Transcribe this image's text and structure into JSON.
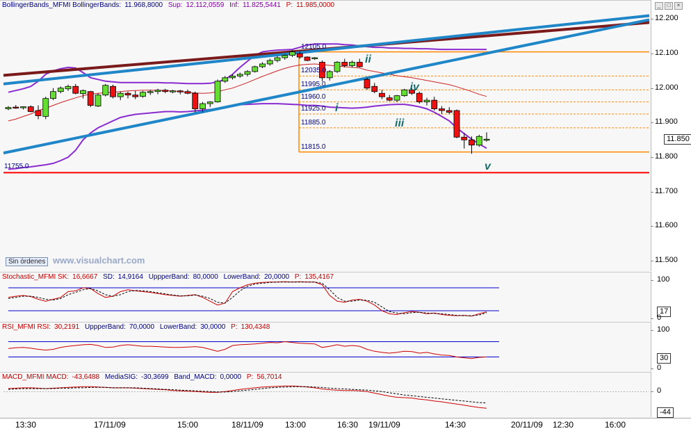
{
  "chart_data": [
    {
      "type": "candlestick",
      "pane": "price",
      "title": "BollingerBands_MFMI BollingerBands:",
      "header_values": [
        {
          "label": "BollingerBands_MFMI BollingerBands:",
          "value": "11.968,8000",
          "color": "#000080"
        },
        {
          "label": "Sup:",
          "value": "12.112,0559",
          "color": "#8000a0"
        },
        {
          "label": "Inf:",
          "value": "11.825,5441",
          "color": "#8000a0"
        },
        {
          "label": "P:",
          "value": "11.985,0000",
          "color": "#c00000"
        }
      ],
      "ylim": [
        11480,
        12225
      ],
      "y_ticks": [
        "12.200",
        "12.100",
        "12.000",
        "11.900",
        "11.800",
        "11.700",
        "11.600",
        "11.500"
      ],
      "y_tick_values": [
        12200,
        12100,
        12000,
        11900,
        11800,
        11700,
        11600,
        11500
      ],
      "last_price": "11.850",
      "candles": [
        [
          11940,
          11948,
          11936,
          11944
        ],
        [
          11945,
          11951,
          11940,
          11943
        ],
        [
          11944,
          11947,
          11938,
          11946
        ],
        [
          11946,
          11950,
          11930,
          11932
        ],
        [
          11935,
          11950,
          11910,
          11920
        ],
        [
          11918,
          11975,
          11910,
          11970
        ],
        [
          11970,
          12000,
          11965,
          11990
        ],
        [
          11990,
          12005,
          11985,
          12000
        ],
        [
          11998,
          12010,
          11992,
          12005
        ],
        [
          12005,
          12012,
          11982,
          11985
        ],
        [
          11984,
          11996,
          11970,
          11993
        ],
        [
          11990,
          11992,
          11945,
          11950
        ],
        [
          11948,
          11985,
          11945,
          11980
        ],
        [
          11980,
          12012,
          11976,
          12008
        ],
        [
          12005,
          12010,
          11970,
          11975
        ],
        [
          11975,
          11990,
          11965,
          11985
        ],
        [
          11985,
          11990,
          11970,
          11980
        ],
        [
          11980,
          11992,
          11968,
          11975
        ],
        [
          11976,
          11992,
          11972,
          11988
        ],
        [
          11988,
          11995,
          11980,
          11990
        ],
        [
          11990,
          11998,
          11982,
          11994
        ],
        [
          11994,
          11998,
          11985,
          11990
        ],
        [
          11990,
          11995,
          11985,
          11992
        ],
        [
          11992,
          11995,
          11982,
          11990
        ],
        [
          11990,
          11996,
          11982,
          11985
        ],
        [
          11985,
          11990,
          11930,
          11940
        ],
        [
          11940,
          11960,
          11930,
          11955
        ],
        [
          11955,
          11962,
          11945,
          11960
        ],
        [
          11960,
          12025,
          11958,
          12020
        ],
        [
          12020,
          12035,
          12015,
          12030
        ],
        [
          12030,
          12040,
          12025,
          12035
        ],
        [
          12035,
          12045,
          12030,
          12040
        ],
        [
          12040,
          12052,
          12034,
          12048
        ],
        [
          12048,
          12065,
          12045,
          12062
        ],
        [
          12062,
          12075,
          12058,
          12070
        ],
        [
          12070,
          12085,
          12065,
          12080
        ],
        [
          12080,
          12092,
          12075,
          12088
        ],
        [
          12088,
          12098,
          12082,
          12095
        ],
        [
          12095,
          12110,
          12090,
          12105
        ],
        [
          12100,
          12106,
          12085,
          12090
        ],
        [
          12090,
          12092,
          12078,
          12080
        ],
        [
          12085,
          12090,
          12082,
          12088
        ],
        [
          12075,
          12080,
          12020,
          12030
        ],
        [
          12030,
          12052,
          12022,
          12048
        ],
        [
          12048,
          12078,
          12044,
          12075
        ],
        [
          12075,
          12085,
          12060,
          12065
        ],
        [
          12065,
          12080,
          12060,
          12075
        ],
        [
          12075,
          12085,
          12060,
          12062
        ],
        [
          12025,
          12030,
          11995,
          12000
        ],
        [
          12005,
          12015,
          11985,
          11990
        ],
        [
          11985,
          11995,
          11968,
          11975
        ],
        [
          11972,
          11980,
          11962,
          11965
        ],
        [
          11965,
          11980,
          11960,
          11978
        ],
        [
          11978,
          11998,
          11975,
          11995
        ],
        [
          11995,
          12000,
          11980,
          11985
        ],
        [
          11985,
          11990,
          11955,
          11960
        ],
        [
          11960,
          11972,
          11950,
          11965
        ],
        [
          11965,
          11975,
          11935,
          11940
        ],
        [
          11940,
          11948,
          11925,
          11935
        ],
        [
          11935,
          11945,
          11925,
          11930
        ],
        [
          11935,
          11938,
          11855,
          11858
        ],
        [
          11858,
          11870,
          11825,
          11850
        ],
        [
          11850,
          11860,
          11810,
          11835
        ],
        [
          11835,
          11865,
          11830,
          11860
        ],
        [
          11850,
          11872,
          11845,
          11852
        ]
      ],
      "bollinger_mid": [
        11905,
        11910,
        11918,
        11925,
        11935,
        11942,
        11950,
        11958,
        11965,
        11972,
        11978,
        11983,
        11985,
        11987,
        11988,
        11990,
        11992,
        11993,
        11994,
        11994,
        11994,
        11993,
        11992,
        11990,
        11988,
        11986,
        11985,
        11986,
        11990,
        11995,
        12000,
        12008,
        12016,
        12025,
        12034,
        12042,
        12050,
        12057,
        12063,
        12067,
        12069,
        12070,
        12068,
        12066,
        12064,
        12062,
        12060,
        12058,
        12052,
        12048,
        12044,
        12040,
        12036,
        12033,
        12030,
        12026,
        12022,
        12018,
        12014,
        12010,
        12004,
        11997,
        11990,
        11982,
        11976
      ],
      "bollinger_upper": [
        11988,
        11993,
        11998,
        12005,
        12020,
        12040,
        12050,
        12056,
        12060,
        12058,
        12045,
        12030,
        12025,
        12020,
        12018,
        12016,
        12016,
        12016,
        12016,
        12016,
        12016,
        12015,
        12015,
        12014,
        12013,
        12013,
        12013,
        12014,
        12018,
        12025,
        12040,
        12060,
        12078,
        12095,
        12105,
        12108,
        12110,
        12111,
        12112,
        12118,
        12125,
        12128,
        12128,
        12128,
        12128,
        12126,
        12125,
        12122,
        12120,
        12118,
        12118,
        12116,
        12116,
        12115,
        12115,
        12114,
        12114,
        12113,
        12112,
        12112,
        12112,
        12112,
        12112,
        12112,
        12112
      ],
      "bollinger_lower": [
        11765,
        11767,
        11770,
        11772,
        11775,
        11778,
        11782,
        11790,
        11800,
        11820,
        11850,
        11870,
        11885,
        11895,
        11905,
        11915,
        11920,
        11924,
        11926,
        11928,
        11930,
        11932,
        11932,
        11931,
        11932,
        11934,
        11936,
        11938,
        11940,
        11945,
        11950,
        11952,
        11953,
        11954,
        11955,
        11955,
        11955,
        11954,
        11953,
        11952,
        11950,
        11950,
        11948,
        11945,
        11944,
        11943,
        11942,
        11943,
        11945,
        11948,
        11950,
        11952,
        11953,
        11953,
        11950,
        11946,
        11940,
        11930,
        11918,
        11905,
        11885,
        11868,
        11852,
        11838,
        11826
      ],
      "levels": [
        {
          "label": "12105.0",
          "value": 12105
        },
        {
          "label": "12035.0",
          "value": 12035
        },
        {
          "label": "11995.0",
          "value": 11995
        },
        {
          "label": "11960.0",
          "value": 11960
        },
        {
          "label": "11925.0",
          "value": 11925
        },
        {
          "label": "11885.0",
          "value": 11885
        },
        {
          "label": "11815.0",
          "value": 11815
        }
      ],
      "support": {
        "label": "11755.0",
        "value": 11755
      },
      "wave_labels": [
        "i",
        "ii",
        "iii",
        "iv",
        "v"
      ],
      "trendlines_color": [
        "#1f86c8",
        "#7a1a1a"
      ]
    },
    {
      "type": "line",
      "pane": "stochastic",
      "header_values": [
        {
          "label": "Stochastic_MFMI SK:",
          "value": "16,6667",
          "color": "#c00000"
        },
        {
          "label": "SD:",
          "value": "14,9164",
          "color": "#000080"
        },
        {
          "label": "UppperBand:",
          "value": "80,0000",
          "color": "#000080"
        },
        {
          "label": "LowerBand:",
          "value": "20,0000",
          "color": "#000080"
        },
        {
          "label": "P:",
          "value": "135,4167",
          "color": "#c00000"
        }
      ],
      "ylim": [
        0,
        100
      ],
      "y_ticks": [
        "100",
        "0"
      ],
      "bands": [
        80,
        20
      ],
      "last_value": "17",
      "series": [
        {
          "name": "SK",
          "values": [
            55,
            58,
            60,
            57,
            50,
            45,
            50,
            55,
            70,
            72,
            80,
            78,
            65,
            55,
            58,
            70,
            75,
            72,
            70,
            68,
            65,
            62,
            60,
            58,
            60,
            62,
            55,
            45,
            35,
            40,
            70,
            80,
            88,
            92,
            94,
            95,
            95,
            96,
            95,
            96,
            95,
            95,
            88,
            60,
            45,
            42,
            48,
            50,
            45,
            35,
            20,
            12,
            10,
            15,
            18,
            16,
            12,
            14,
            10,
            8,
            7,
            8,
            6,
            12,
            17
          ]
        },
        {
          "name": "SD",
          "values": [
            52,
            55,
            58,
            58,
            55,
            50,
            48,
            52,
            62,
            68,
            75,
            78,
            72,
            62,
            58,
            62,
            70,
            73,
            72,
            70,
            67,
            64,
            61,
            59,
            59,
            61,
            58,
            52,
            42,
            40,
            55,
            72,
            84,
            90,
            92,
            94,
            95,
            95,
            95,
            95,
            95,
            95,
            92,
            75,
            55,
            45,
            45,
            48,
            47,
            42,
            30,
            18,
            14,
            12,
            15,
            16,
            14,
            13,
            12,
            10,
            8,
            7,
            7,
            9,
            15
          ]
        }
      ]
    },
    {
      "type": "line",
      "pane": "rsi",
      "header_values": [
        {
          "label": "RSI_MFMI RSI:",
          "value": "30,2191",
          "color": "#c00000"
        },
        {
          "label": "UppperBand:",
          "value": "70,0000",
          "color": "#000080"
        },
        {
          "label": "LowerBand:",
          "value": "30,0000",
          "color": "#000080"
        },
        {
          "label": "P:",
          "value": "130,4348",
          "color": "#c00000"
        }
      ],
      "ylim": [
        0,
        100
      ],
      "y_ticks": [
        "100",
        "0"
      ],
      "bands": [
        70,
        30
      ],
      "last_value": "30",
      "series": [
        {
          "name": "RSI",
          "values": [
            52,
            54,
            55,
            53,
            50,
            48,
            50,
            55,
            58,
            60,
            62,
            63,
            60,
            55,
            56,
            60,
            62,
            60,
            58,
            58,
            57,
            56,
            55,
            55,
            56,
            57,
            55,
            50,
            45,
            50,
            60,
            62,
            63,
            64,
            66,
            68,
            67,
            70,
            68,
            66,
            65,
            64,
            55,
            58,
            62,
            58,
            60,
            58,
            50,
            45,
            42,
            40,
            42,
            45,
            44,
            40,
            42,
            38,
            35,
            34,
            30,
            28,
            26,
            29,
            30
          ]
        }
      ]
    },
    {
      "type": "line",
      "pane": "macd",
      "header_values": [
        {
          "label": "MACD_MFMI MACD:",
          "value": "-43,6488",
          "color": "#c00000"
        },
        {
          "label": "MediaSIG:",
          "value": "-30,3699",
          "color": "#000080"
        },
        {
          "label": "Band_MACD:",
          "value": "0,0000",
          "color": "#000080"
        },
        {
          "label": "P:",
          "value": "56,7014",
          "color": "#c00000"
        }
      ],
      "ylim": [
        -60,
        30
      ],
      "y_ticks": [
        "0"
      ],
      "last_value": "-44",
      "series": [
        {
          "name": "MACD",
          "values": [
            8,
            9,
            10,
            10,
            9,
            8,
            9,
            10,
            11,
            12,
            13,
            13,
            12,
            11,
            10,
            10,
            10,
            9,
            8,
            7,
            6,
            5,
            3,
            2,
            1,
            0,
            -1,
            -2,
            -2,
            0,
            3,
            6,
            8,
            10,
            12,
            13,
            14,
            15,
            15,
            14,
            12,
            10,
            7,
            5,
            4,
            3,
            3,
            2,
            0,
            -4,
            -8,
            -12,
            -15,
            -16,
            -17,
            -20,
            -22,
            -25,
            -27,
            -30,
            -33,
            -36,
            -39,
            -42,
            -44
          ]
        },
        {
          "name": "SIG",
          "values": [
            6,
            7,
            8,
            8,
            8,
            8,
            8,
            9,
            9,
            10,
            10,
            11,
            11,
            11,
            10,
            10,
            10,
            10,
            9,
            8,
            7,
            6,
            5,
            4,
            3,
            2,
            1,
            0,
            -1,
            -1,
            0,
            2,
            4,
            6,
            8,
            10,
            11,
            12,
            13,
            13,
            13,
            12,
            11,
            9,
            8,
            7,
            6,
            5,
            4,
            2,
            0,
            -3,
            -6,
            -9,
            -11,
            -13,
            -15,
            -17,
            -19,
            -21,
            -23,
            -25,
            -27,
            -29,
            -30
          ]
        }
      ]
    }
  ],
  "x_axis": {
    "labels": [
      "13:30",
      "17/11/09",
      "15:00",
      "18/11/09",
      "13:00",
      "16:30",
      "19/11/09",
      "14:30",
      "20/11/09",
      "12:30",
      "16:00"
    ]
  },
  "ui": {
    "order_badge": "Sin órdenes",
    "watermark": "www.visualchart.com",
    "win_buttons": [
      "_",
      "□",
      "×"
    ]
  },
  "colors": {
    "up": "#66dd33",
    "down": "#ee1111",
    "bb_mid": "#cc2222",
    "bb_band": "#8a2bd0",
    "levels": "#ff8800",
    "support": "#ff0000",
    "wave": "#1a6e6e"
  }
}
